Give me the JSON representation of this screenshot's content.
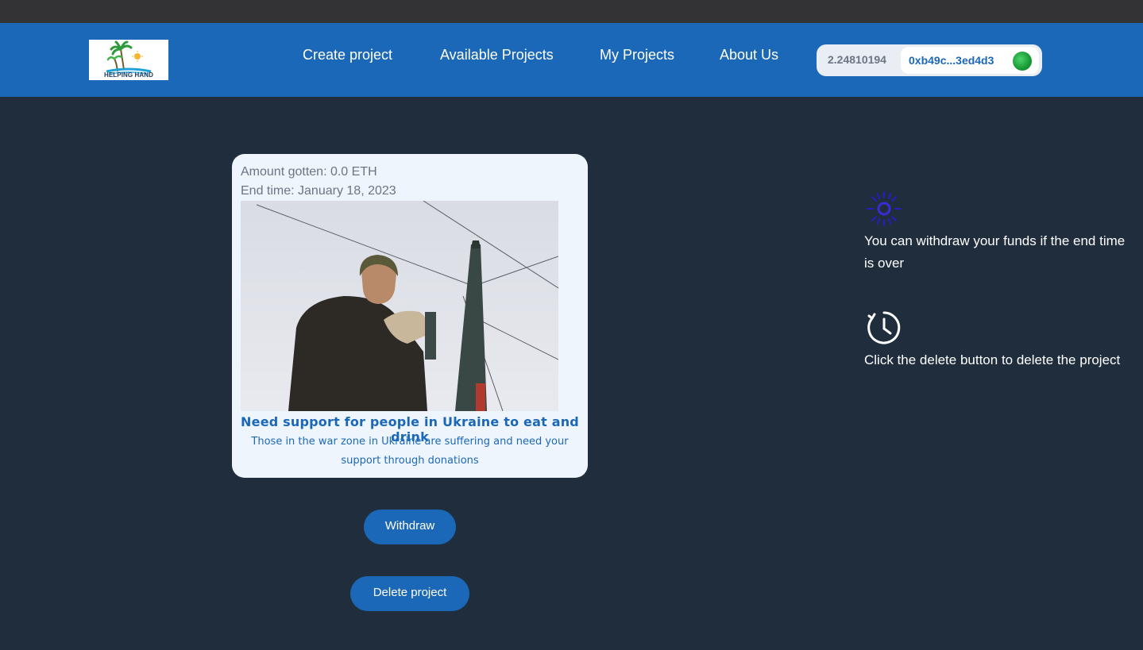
{
  "header": {
    "logo_text": "HELPING HAND",
    "nav": [
      {
        "label": "Create project"
      },
      {
        "label": "Available Projects"
      },
      {
        "label": "My Projects"
      },
      {
        "label": "About Us"
      }
    ],
    "wallet": {
      "balance": "2.24810194",
      "address": "0xb49c...3ed4d3",
      "avatar_icon": "green-identicon"
    }
  },
  "project_card": {
    "amount": "Amount gotten: 0.0 ETH",
    "end_time": "End time: January 18, 2023",
    "image_alt": "soldier-repairing-power-line-photo",
    "title": "Need support for people in Ukraine to eat and drink",
    "description": "Those in the war zone in Ukraine are suffering and need your support through donations"
  },
  "actions": {
    "withdraw_label": "Withdraw",
    "delete_label": "Delete project"
  },
  "info": [
    {
      "icon": "loading-spinner-icon",
      "text": "You can withdraw your funds if the end time is over"
    },
    {
      "icon": "timer-icon",
      "text": "Click the delete button to delete the project"
    }
  ],
  "colors": {
    "navbar": "#1c68b8",
    "background": "#1f2d3d",
    "accent": "#1c68b8",
    "card": "#eef5fc"
  }
}
